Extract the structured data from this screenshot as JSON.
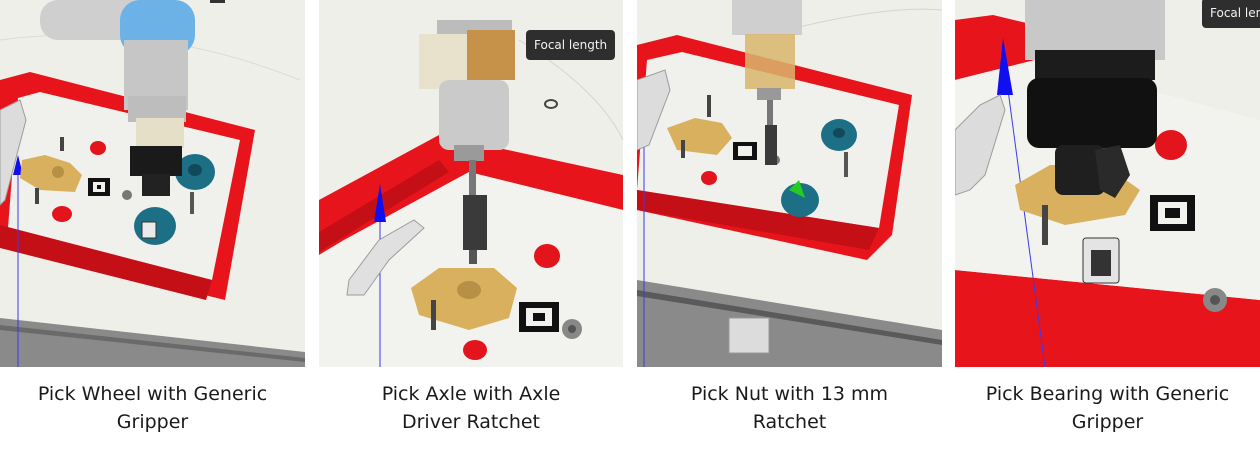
{
  "panels": [
    {
      "caption_line1": "Pick Wheel with Generic",
      "caption_line2": "Gripper"
    },
    {
      "caption_line1": "Pick Axle with Axle",
      "caption_line2": "Driver Ratchet",
      "tooltip": "Focal length"
    },
    {
      "caption_line1": "Pick Nut with 13 mm",
      "caption_line2": "Ratchet"
    },
    {
      "caption_line1": "Pick Bearing with Generic",
      "caption_line2": "Gripper",
      "tooltip": "Focal leng"
    }
  ],
  "colors": {
    "tray_red": "#e8141c",
    "floor": "#eeeee8",
    "brass": "#d9b15e",
    "teal_wheel": "#1d6f86",
    "robot_gray": "#c9c9c9",
    "arrow_blue": "#1010ee",
    "arrow_green": "#22cc22"
  }
}
